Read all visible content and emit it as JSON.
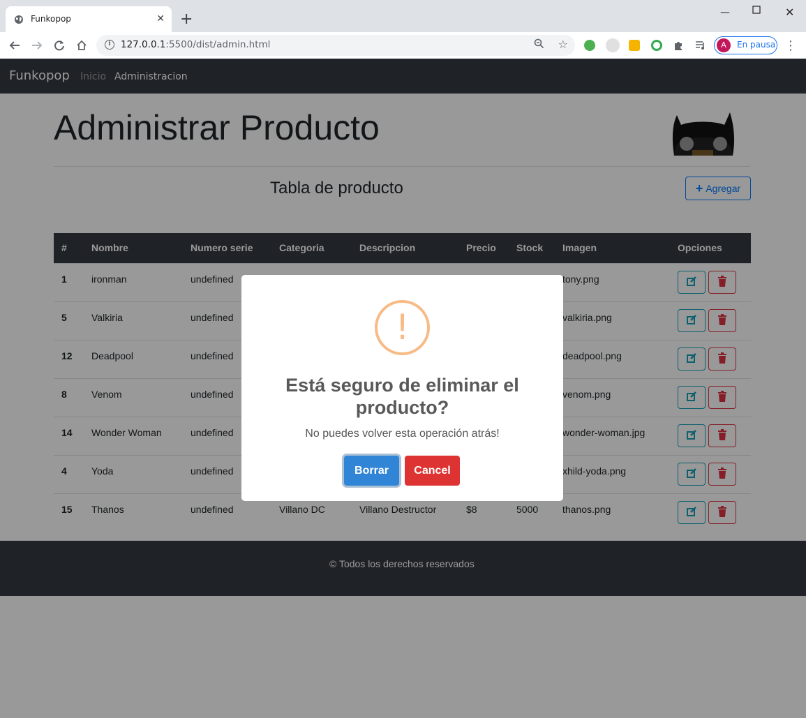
{
  "browser": {
    "tab_title": "Funkopop",
    "url_host": "127.0.0.1",
    "url_rest": ":5500/dist/admin.html",
    "profile_initial": "A",
    "profile_label": "En pausa"
  },
  "navbar": {
    "brand": "Funkopop",
    "links": [
      "Inicio",
      "Administracion"
    ]
  },
  "main": {
    "title": "Administrar Producto",
    "table_title": "Tabla de producto",
    "add_button": "Agregar"
  },
  "table": {
    "headers": [
      "#",
      "Nombre",
      "Numero serie",
      "Categoria",
      "Descripcion",
      "Precio",
      "Stock",
      "Imagen",
      "Opciones"
    ],
    "rows": [
      {
        "id": "1",
        "nombre": "ironman",
        "serie": "undefined",
        "categoria": "",
        "descripcion": "",
        "precio": "",
        "stock": "",
        "imagen": "tony.png"
      },
      {
        "id": "5",
        "nombre": "Valkiria",
        "serie": "undefined",
        "categoria": "",
        "descripcion": "",
        "precio": "",
        "stock": "",
        "imagen": "valkiria.png"
      },
      {
        "id": "12",
        "nombre": "Deadpool",
        "serie": "undefined",
        "categoria": "",
        "descripcion": "",
        "precio": "",
        "stock": "",
        "imagen": "deadpool.png"
      },
      {
        "id": "8",
        "nombre": "Venom",
        "serie": "undefined",
        "categoria": "",
        "descripcion": "",
        "precio": "",
        "stock": "",
        "imagen": "venom.png"
      },
      {
        "id": "14",
        "nombre": "Wonder Woman",
        "serie": "undefined",
        "categoria": "",
        "descripcion": "",
        "precio": "",
        "stock": "",
        "imagen": "wonder-woman.jpg"
      },
      {
        "id": "4",
        "nombre": "Yoda",
        "serie": "undefined",
        "categoria": "",
        "descripcion": "",
        "precio": "",
        "stock": "",
        "imagen": "xhild-yoda.png"
      },
      {
        "id": "15",
        "nombre": "Thanos",
        "serie": "undefined",
        "categoria": "Villano DC",
        "descripcion": "Villano Destructor",
        "precio": "$8",
        "stock": "5000",
        "imagen": "thanos.png"
      }
    ]
  },
  "footer": {
    "text": "© Todos los derechos reservados"
  },
  "modal": {
    "icon": "!",
    "title": "Está seguro de eliminar el producto?",
    "text": "No puedes volver esta operación atrás!",
    "confirm": "Borrar",
    "cancel": "Cancel"
  },
  "colors": {
    "navbar": "#343a40",
    "primary": "#007bff",
    "info": "#17a2b8",
    "danger": "#dc3545",
    "warning_icon": "#f8bb86",
    "confirm_button": "#3085d6",
    "cancel_button": "#dd3333"
  },
  "icons": [
    "globe-icon",
    "back-arrow-icon",
    "forward-arrow-icon",
    "reload-icon",
    "home-icon",
    "info-icon",
    "zoom-icon",
    "star-icon",
    "puzzle-icon",
    "media-icon",
    "edit-icon",
    "trash-icon",
    "plus-icon",
    "warning-icon"
  ]
}
